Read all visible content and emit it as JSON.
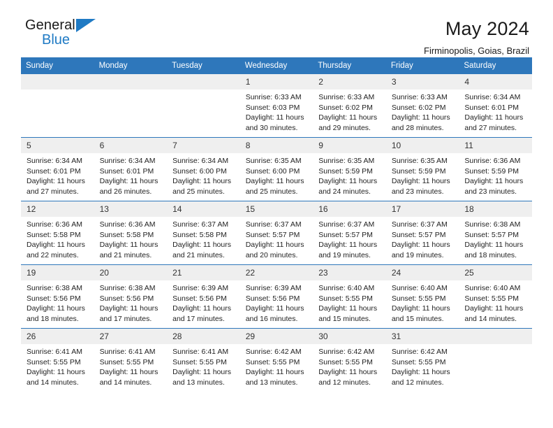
{
  "logo": {
    "name_top": "General",
    "name_bottom": "Blue",
    "triangle_icon": "blue-triangle-icon",
    "brand_color": "#1f7ac4"
  },
  "header": {
    "title": "May 2024",
    "subtitle": "Firminopolis, Goias, Brazil"
  },
  "theme": {
    "header_blue": "#2e77bb",
    "daynum_band": "#efefef"
  },
  "weekdays": [
    "Sunday",
    "Monday",
    "Tuesday",
    "Wednesday",
    "Thursday",
    "Friday",
    "Saturday"
  ],
  "weeks": [
    [
      {
        "day": "",
        "lines": []
      },
      {
        "day": "",
        "lines": []
      },
      {
        "day": "",
        "lines": []
      },
      {
        "day": "1",
        "lines": [
          "Sunrise: 6:33 AM",
          "Sunset: 6:03 PM",
          "Daylight: 11 hours",
          "and 30 minutes."
        ]
      },
      {
        "day": "2",
        "lines": [
          "Sunrise: 6:33 AM",
          "Sunset: 6:02 PM",
          "Daylight: 11 hours",
          "and 29 minutes."
        ]
      },
      {
        "day": "3",
        "lines": [
          "Sunrise: 6:33 AM",
          "Sunset: 6:02 PM",
          "Daylight: 11 hours",
          "and 28 minutes."
        ]
      },
      {
        "day": "4",
        "lines": [
          "Sunrise: 6:34 AM",
          "Sunset: 6:01 PM",
          "Daylight: 11 hours",
          "and 27 minutes."
        ]
      }
    ],
    [
      {
        "day": "5",
        "lines": [
          "Sunrise: 6:34 AM",
          "Sunset: 6:01 PM",
          "Daylight: 11 hours",
          "and 27 minutes."
        ]
      },
      {
        "day": "6",
        "lines": [
          "Sunrise: 6:34 AM",
          "Sunset: 6:01 PM",
          "Daylight: 11 hours",
          "and 26 minutes."
        ]
      },
      {
        "day": "7",
        "lines": [
          "Sunrise: 6:34 AM",
          "Sunset: 6:00 PM",
          "Daylight: 11 hours",
          "and 25 minutes."
        ]
      },
      {
        "day": "8",
        "lines": [
          "Sunrise: 6:35 AM",
          "Sunset: 6:00 PM",
          "Daylight: 11 hours",
          "and 25 minutes."
        ]
      },
      {
        "day": "9",
        "lines": [
          "Sunrise: 6:35 AM",
          "Sunset: 5:59 PM",
          "Daylight: 11 hours",
          "and 24 minutes."
        ]
      },
      {
        "day": "10",
        "lines": [
          "Sunrise: 6:35 AM",
          "Sunset: 5:59 PM",
          "Daylight: 11 hours",
          "and 23 minutes."
        ]
      },
      {
        "day": "11",
        "lines": [
          "Sunrise: 6:36 AM",
          "Sunset: 5:59 PM",
          "Daylight: 11 hours",
          "and 23 minutes."
        ]
      }
    ],
    [
      {
        "day": "12",
        "lines": [
          "Sunrise: 6:36 AM",
          "Sunset: 5:58 PM",
          "Daylight: 11 hours",
          "and 22 minutes."
        ]
      },
      {
        "day": "13",
        "lines": [
          "Sunrise: 6:36 AM",
          "Sunset: 5:58 PM",
          "Daylight: 11 hours",
          "and 21 minutes."
        ]
      },
      {
        "day": "14",
        "lines": [
          "Sunrise: 6:37 AM",
          "Sunset: 5:58 PM",
          "Daylight: 11 hours",
          "and 21 minutes."
        ]
      },
      {
        "day": "15",
        "lines": [
          "Sunrise: 6:37 AM",
          "Sunset: 5:57 PM",
          "Daylight: 11 hours",
          "and 20 minutes."
        ]
      },
      {
        "day": "16",
        "lines": [
          "Sunrise: 6:37 AM",
          "Sunset: 5:57 PM",
          "Daylight: 11 hours",
          "and 19 minutes."
        ]
      },
      {
        "day": "17",
        "lines": [
          "Sunrise: 6:37 AM",
          "Sunset: 5:57 PM",
          "Daylight: 11 hours",
          "and 19 minutes."
        ]
      },
      {
        "day": "18",
        "lines": [
          "Sunrise: 6:38 AM",
          "Sunset: 5:57 PM",
          "Daylight: 11 hours",
          "and 18 minutes."
        ]
      }
    ],
    [
      {
        "day": "19",
        "lines": [
          "Sunrise: 6:38 AM",
          "Sunset: 5:56 PM",
          "Daylight: 11 hours",
          "and 18 minutes."
        ]
      },
      {
        "day": "20",
        "lines": [
          "Sunrise: 6:38 AM",
          "Sunset: 5:56 PM",
          "Daylight: 11 hours",
          "and 17 minutes."
        ]
      },
      {
        "day": "21",
        "lines": [
          "Sunrise: 6:39 AM",
          "Sunset: 5:56 PM",
          "Daylight: 11 hours",
          "and 17 minutes."
        ]
      },
      {
        "day": "22",
        "lines": [
          "Sunrise: 6:39 AM",
          "Sunset: 5:56 PM",
          "Daylight: 11 hours",
          "and 16 minutes."
        ]
      },
      {
        "day": "23",
        "lines": [
          "Sunrise: 6:40 AM",
          "Sunset: 5:55 PM",
          "Daylight: 11 hours",
          "and 15 minutes."
        ]
      },
      {
        "day": "24",
        "lines": [
          "Sunrise: 6:40 AM",
          "Sunset: 5:55 PM",
          "Daylight: 11 hours",
          "and 15 minutes."
        ]
      },
      {
        "day": "25",
        "lines": [
          "Sunrise: 6:40 AM",
          "Sunset: 5:55 PM",
          "Daylight: 11 hours",
          "and 14 minutes."
        ]
      }
    ],
    [
      {
        "day": "26",
        "lines": [
          "Sunrise: 6:41 AM",
          "Sunset: 5:55 PM",
          "Daylight: 11 hours",
          "and 14 minutes."
        ]
      },
      {
        "day": "27",
        "lines": [
          "Sunrise: 6:41 AM",
          "Sunset: 5:55 PM",
          "Daylight: 11 hours",
          "and 14 minutes."
        ]
      },
      {
        "day": "28",
        "lines": [
          "Sunrise: 6:41 AM",
          "Sunset: 5:55 PM",
          "Daylight: 11 hours",
          "and 13 minutes."
        ]
      },
      {
        "day": "29",
        "lines": [
          "Sunrise: 6:42 AM",
          "Sunset: 5:55 PM",
          "Daylight: 11 hours",
          "and 13 minutes."
        ]
      },
      {
        "day": "30",
        "lines": [
          "Sunrise: 6:42 AM",
          "Sunset: 5:55 PM",
          "Daylight: 11 hours",
          "and 12 minutes."
        ]
      },
      {
        "day": "31",
        "lines": [
          "Sunrise: 6:42 AM",
          "Sunset: 5:55 PM",
          "Daylight: 11 hours",
          "and 12 minutes."
        ]
      },
      {
        "day": "",
        "lines": []
      }
    ]
  ]
}
